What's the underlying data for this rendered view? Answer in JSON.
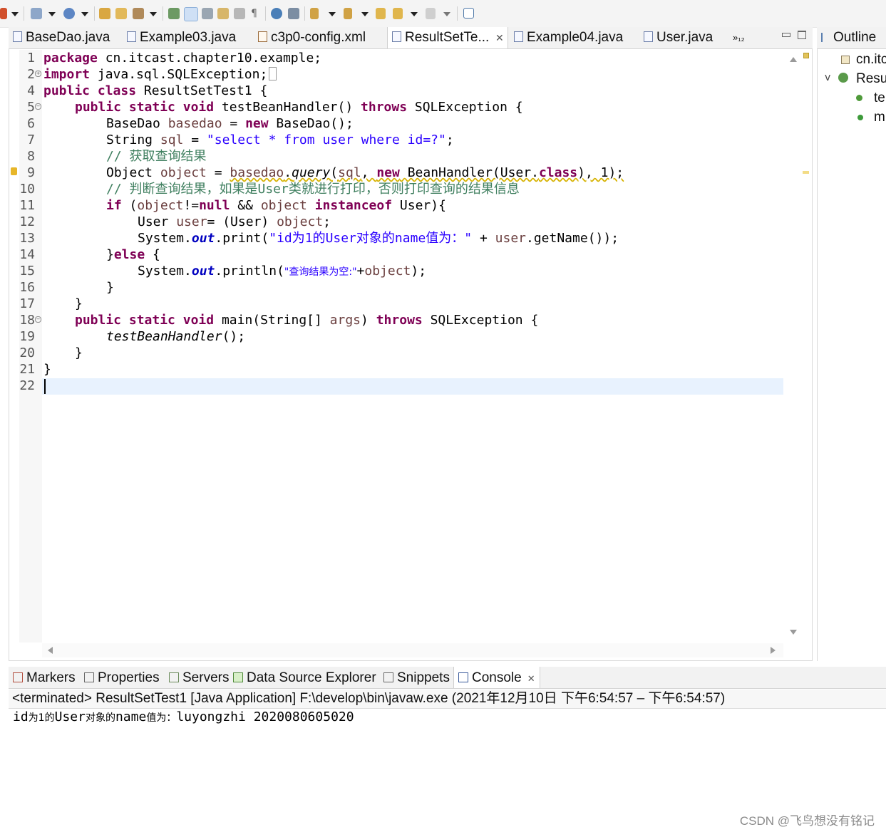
{
  "toolbar": {
    "icons": [
      "debug-icon",
      "new-wizard-icon",
      "run-icon",
      "open-type-icon",
      "open-resource-icon",
      "search-icon",
      "annotation-icon",
      "highlight-icon",
      "toggle-mark-icon",
      "block-selection-icon",
      "show-whitespace-icon",
      "web-browser-icon",
      "server-icon",
      "next-annotation-icon",
      "prev-annotation-icon",
      "last-edit-icon",
      "back-icon",
      "forward-icon",
      "pin-editor-icon"
    ]
  },
  "editor": {
    "tabs": [
      {
        "label": "BaseDao.java",
        "active": false
      },
      {
        "label": "Example03.java",
        "active": false
      },
      {
        "label": "c3p0-config.xml",
        "active": false
      },
      {
        "label": "ResultSetTe...",
        "active": true
      },
      {
        "label": "Example04.java",
        "active": false
      },
      {
        "label": "User.java",
        "active": false
      }
    ],
    "overflow_count": "»₁₂",
    "line_numbers": [
      "1",
      "2",
      "4",
      "5",
      "6",
      "7",
      "8",
      "9",
      "10",
      "11",
      "12",
      "13",
      "14",
      "15",
      "16",
      "17",
      "18",
      "19",
      "20",
      "21",
      "22"
    ],
    "code": {
      "l1_kw": "package",
      "l1_rest": " cn.itcast.chapter10.example;",
      "l2_kw": "import",
      "l2_rest": " java.sql.SQLException;",
      "l4_kw1": "public",
      "l4_kw2": "class",
      "l4_rest": " ResultSetTest1 {",
      "l5_kw1": "public",
      "l5_kw2": "static",
      "l5_kw3": "void",
      "l5_mid": " testBeanHandler() ",
      "l5_kw4": "throws",
      "l5_end": " SQLException {",
      "l6_a": "BaseDao ",
      "l6_var": "basedao",
      "l6_b": " = ",
      "l6_kw": "new",
      "l6_c": " BaseDao();",
      "l7_a": "String ",
      "l7_var": "sql",
      "l7_b": " = ",
      "l7_str": "\"select * from user where id=?\"",
      "l7_c": ";",
      "l8_cm": "// 获取查询结果",
      "l9_a": "Object ",
      "l9_var": "object",
      "l9_b": " = ",
      "l9_var2": "basedao",
      "l9_c": ".",
      "l9_it": "query",
      "l9_d": "(",
      "l9_var3": "sql",
      "l9_e": ", ",
      "l9_kw": "new",
      "l9_f": " BeanHandler(User.",
      "l9_kw2": "class",
      "l9_g": "), 1);",
      "l10_cm": "// 判断查询结果，如果是User类就进行打印，否则打印查询的结果信息",
      "l11_kw": "if",
      "l11_a": " (",
      "l11_var": "object",
      "l11_b": "!=",
      "l11_kw2": "null",
      "l11_c": " && ",
      "l11_var2": "object",
      "l11_d": " ",
      "l11_kw3": "instanceof",
      "l11_e": " User){",
      "l12_a": "User ",
      "l12_var": "user",
      "l12_b": "= (User) ",
      "l12_var2": "object",
      "l12_c": ";",
      "l13_a": "System.",
      "l13_fld": "out",
      "l13_b": ".print(",
      "l13_str": "\"id为1的User对象的name值为：\"",
      "l13_c": " + ",
      "l13_var": "user",
      "l13_d": ".getName());",
      "l14_a": "}",
      "l14_kw": "else",
      "l14_b": " {",
      "l15_a": "System.",
      "l15_fld": "out",
      "l15_b": ".println(",
      "l15_str": "\"查询结果为空:\"",
      "l15_c": "+",
      "l15_var": "object",
      "l15_d": ");",
      "l16": "}",
      "l17": "}",
      "l18_kw1": "public",
      "l18_kw2": "static",
      "l18_kw3": "void",
      "l18_mid": " main(String[] ",
      "l18_var": "args",
      "l18_b": ") ",
      "l18_kw4": "throws",
      "l18_end": " SQLException {",
      "l19_it": "testBeanHandler",
      "l19_rest": "();",
      "l20": "}",
      "l21": "}"
    }
  },
  "outline": {
    "title": "Outline",
    "items": [
      "cn.itc",
      "Resu",
      "te",
      "m"
    ]
  },
  "bottom": {
    "tabs": [
      {
        "label": "Markers"
      },
      {
        "label": "Properties"
      },
      {
        "label": "Servers"
      },
      {
        "label": "Data Source Explorer"
      },
      {
        "label": "Snippets"
      },
      {
        "label": "Console",
        "active": true
      }
    ],
    "console_header": "<terminated> ResultSetTest1 [Java Application] F:\\develop\\bin\\javaw.exe  (2021年12月10日 下午6:54:57 – 下午6:54:57)",
    "console_output_a": "id",
    "console_output_b": "为1的",
    "console_output_c": "User",
    "console_output_d": "对象的",
    "console_output_e": "name",
    "console_output_f": "值为：",
    "console_output_g": "luyongzhi 2020080605020"
  },
  "watermark": "CSDN @飞鸟想没有铭记",
  "colors": {
    "keyword": "#7f0055",
    "string": "#2a00ff",
    "comment": "#3f7f5f",
    "field": "#0000c0",
    "variable": "#6a3e3e",
    "current_line": "#e8f2fe"
  }
}
